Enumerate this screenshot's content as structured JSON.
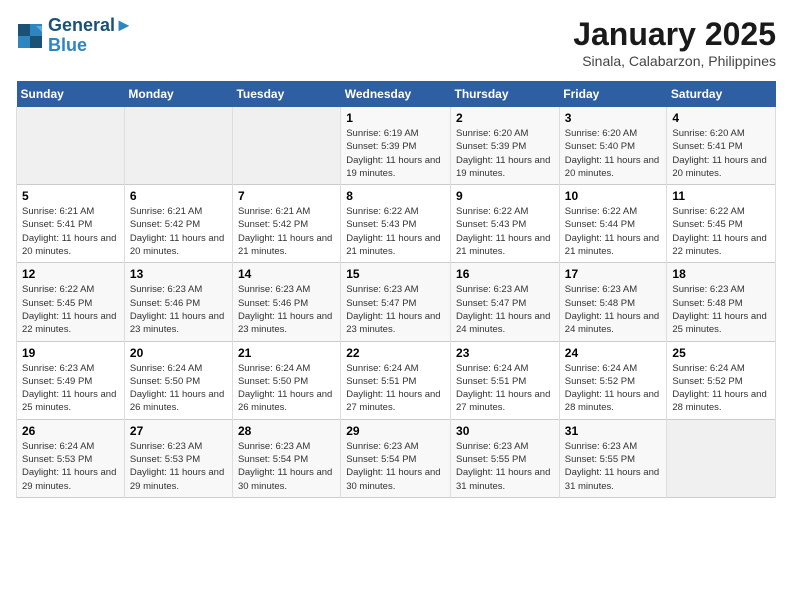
{
  "header": {
    "logo_line1": "General",
    "logo_line2": "Blue",
    "month": "January 2025",
    "location": "Sinala, Calabarzon, Philippines"
  },
  "weekdays": [
    "Sunday",
    "Monday",
    "Tuesday",
    "Wednesday",
    "Thursday",
    "Friday",
    "Saturday"
  ],
  "weeks": [
    [
      {
        "day": "",
        "info": ""
      },
      {
        "day": "",
        "info": ""
      },
      {
        "day": "",
        "info": ""
      },
      {
        "day": "1",
        "info": "Sunrise: 6:19 AM\nSunset: 5:39 PM\nDaylight: 11 hours and 19 minutes."
      },
      {
        "day": "2",
        "info": "Sunrise: 6:20 AM\nSunset: 5:39 PM\nDaylight: 11 hours and 19 minutes."
      },
      {
        "day": "3",
        "info": "Sunrise: 6:20 AM\nSunset: 5:40 PM\nDaylight: 11 hours and 20 minutes."
      },
      {
        "day": "4",
        "info": "Sunrise: 6:20 AM\nSunset: 5:41 PM\nDaylight: 11 hours and 20 minutes."
      }
    ],
    [
      {
        "day": "5",
        "info": "Sunrise: 6:21 AM\nSunset: 5:41 PM\nDaylight: 11 hours and 20 minutes."
      },
      {
        "day": "6",
        "info": "Sunrise: 6:21 AM\nSunset: 5:42 PM\nDaylight: 11 hours and 20 minutes."
      },
      {
        "day": "7",
        "info": "Sunrise: 6:21 AM\nSunset: 5:42 PM\nDaylight: 11 hours and 21 minutes."
      },
      {
        "day": "8",
        "info": "Sunrise: 6:22 AM\nSunset: 5:43 PM\nDaylight: 11 hours and 21 minutes."
      },
      {
        "day": "9",
        "info": "Sunrise: 6:22 AM\nSunset: 5:43 PM\nDaylight: 11 hours and 21 minutes."
      },
      {
        "day": "10",
        "info": "Sunrise: 6:22 AM\nSunset: 5:44 PM\nDaylight: 11 hours and 21 minutes."
      },
      {
        "day": "11",
        "info": "Sunrise: 6:22 AM\nSunset: 5:45 PM\nDaylight: 11 hours and 22 minutes."
      }
    ],
    [
      {
        "day": "12",
        "info": "Sunrise: 6:22 AM\nSunset: 5:45 PM\nDaylight: 11 hours and 22 minutes."
      },
      {
        "day": "13",
        "info": "Sunrise: 6:23 AM\nSunset: 5:46 PM\nDaylight: 11 hours and 23 minutes."
      },
      {
        "day": "14",
        "info": "Sunrise: 6:23 AM\nSunset: 5:46 PM\nDaylight: 11 hours and 23 minutes."
      },
      {
        "day": "15",
        "info": "Sunrise: 6:23 AM\nSunset: 5:47 PM\nDaylight: 11 hours and 23 minutes."
      },
      {
        "day": "16",
        "info": "Sunrise: 6:23 AM\nSunset: 5:47 PM\nDaylight: 11 hours and 24 minutes."
      },
      {
        "day": "17",
        "info": "Sunrise: 6:23 AM\nSunset: 5:48 PM\nDaylight: 11 hours and 24 minutes."
      },
      {
        "day": "18",
        "info": "Sunrise: 6:23 AM\nSunset: 5:48 PM\nDaylight: 11 hours and 25 minutes."
      }
    ],
    [
      {
        "day": "19",
        "info": "Sunrise: 6:23 AM\nSunset: 5:49 PM\nDaylight: 11 hours and 25 minutes."
      },
      {
        "day": "20",
        "info": "Sunrise: 6:24 AM\nSunset: 5:50 PM\nDaylight: 11 hours and 26 minutes."
      },
      {
        "day": "21",
        "info": "Sunrise: 6:24 AM\nSunset: 5:50 PM\nDaylight: 11 hours and 26 minutes."
      },
      {
        "day": "22",
        "info": "Sunrise: 6:24 AM\nSunset: 5:51 PM\nDaylight: 11 hours and 27 minutes."
      },
      {
        "day": "23",
        "info": "Sunrise: 6:24 AM\nSunset: 5:51 PM\nDaylight: 11 hours and 27 minutes."
      },
      {
        "day": "24",
        "info": "Sunrise: 6:24 AM\nSunset: 5:52 PM\nDaylight: 11 hours and 28 minutes."
      },
      {
        "day": "25",
        "info": "Sunrise: 6:24 AM\nSunset: 5:52 PM\nDaylight: 11 hours and 28 minutes."
      }
    ],
    [
      {
        "day": "26",
        "info": "Sunrise: 6:24 AM\nSunset: 5:53 PM\nDaylight: 11 hours and 29 minutes."
      },
      {
        "day": "27",
        "info": "Sunrise: 6:23 AM\nSunset: 5:53 PM\nDaylight: 11 hours and 29 minutes."
      },
      {
        "day": "28",
        "info": "Sunrise: 6:23 AM\nSunset: 5:54 PM\nDaylight: 11 hours and 30 minutes."
      },
      {
        "day": "29",
        "info": "Sunrise: 6:23 AM\nSunset: 5:54 PM\nDaylight: 11 hours and 30 minutes."
      },
      {
        "day": "30",
        "info": "Sunrise: 6:23 AM\nSunset: 5:55 PM\nDaylight: 11 hours and 31 minutes."
      },
      {
        "day": "31",
        "info": "Sunrise: 6:23 AM\nSunset: 5:55 PM\nDaylight: 11 hours and 31 minutes."
      },
      {
        "day": "",
        "info": ""
      }
    ]
  ]
}
